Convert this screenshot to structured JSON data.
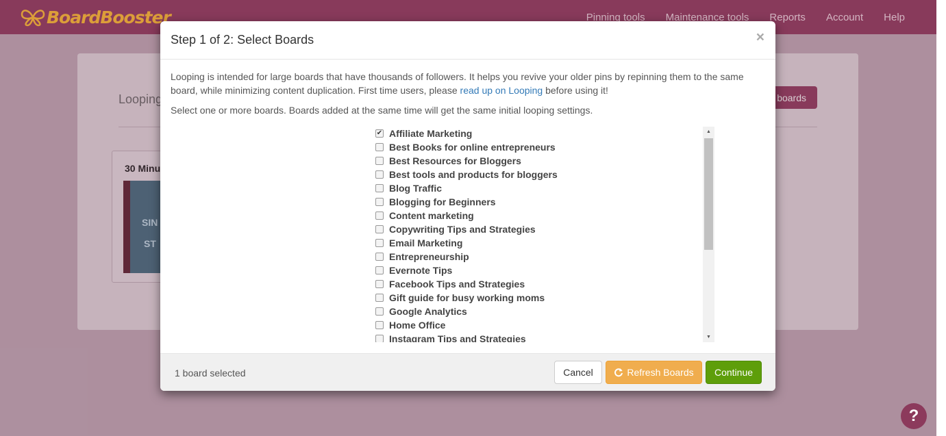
{
  "app": {
    "logo_text": "BoardBooster",
    "nav": [
      "Pinning tools",
      "Maintenance tools",
      "Reports",
      "Account",
      "Help"
    ]
  },
  "background_page": {
    "title": "Looping",
    "add_button_label": "boards",
    "card_title": "30 Minu",
    "card_image_text_1": "SIN",
    "card_image_text_2": "ST"
  },
  "modal": {
    "title": "Step 1 of 2: Select Boards",
    "close_glyph": "×",
    "intro_before_link": "Looping is intended for large boards that have thousands of followers. It helps you revive your older pins by repinning them to the same board, while minimizing content duplication. First time users, please ",
    "intro_link": "read up on Looping",
    "intro_after_link": " before using it!",
    "instruction": "Select one or more boards. Boards added at the same time will get the same initial looping settings.",
    "boards": [
      {
        "name": "Affiliate Marketing",
        "checked": true
      },
      {
        "name": "Best Books for online entrepreneurs",
        "checked": false
      },
      {
        "name": "Best Resources for Bloggers",
        "checked": false
      },
      {
        "name": "Best tools and products for bloggers",
        "checked": false
      },
      {
        "name": "Blog Traffic",
        "checked": false
      },
      {
        "name": "Blogging for Beginners",
        "checked": false
      },
      {
        "name": "Content marketing",
        "checked": false
      },
      {
        "name": "Copywriting Tips and Strategies",
        "checked": false
      },
      {
        "name": "Email Marketing",
        "checked": false
      },
      {
        "name": "Entrepreneurship",
        "checked": false
      },
      {
        "name": "Evernote Tips",
        "checked": false
      },
      {
        "name": "Facebook Tips and Strategies",
        "checked": false
      },
      {
        "name": "Gift guide for busy working moms",
        "checked": false
      },
      {
        "name": "Google Analytics",
        "checked": false
      },
      {
        "name": "Home Office",
        "checked": false
      },
      {
        "name": "Instagram Tips and Strategies",
        "checked": false
      }
    ],
    "footer": {
      "selected_text": "1 board selected",
      "cancel_label": "Cancel",
      "refresh_label": "Refresh Boards",
      "continue_label": "Continue"
    }
  },
  "help_glyph": "?",
  "colors": {
    "brand": "#8c3a5c",
    "logo": "#f2b432",
    "refresh": "#f0ad4e",
    "continue": "#5e9e0a",
    "link": "#337ab7"
  }
}
